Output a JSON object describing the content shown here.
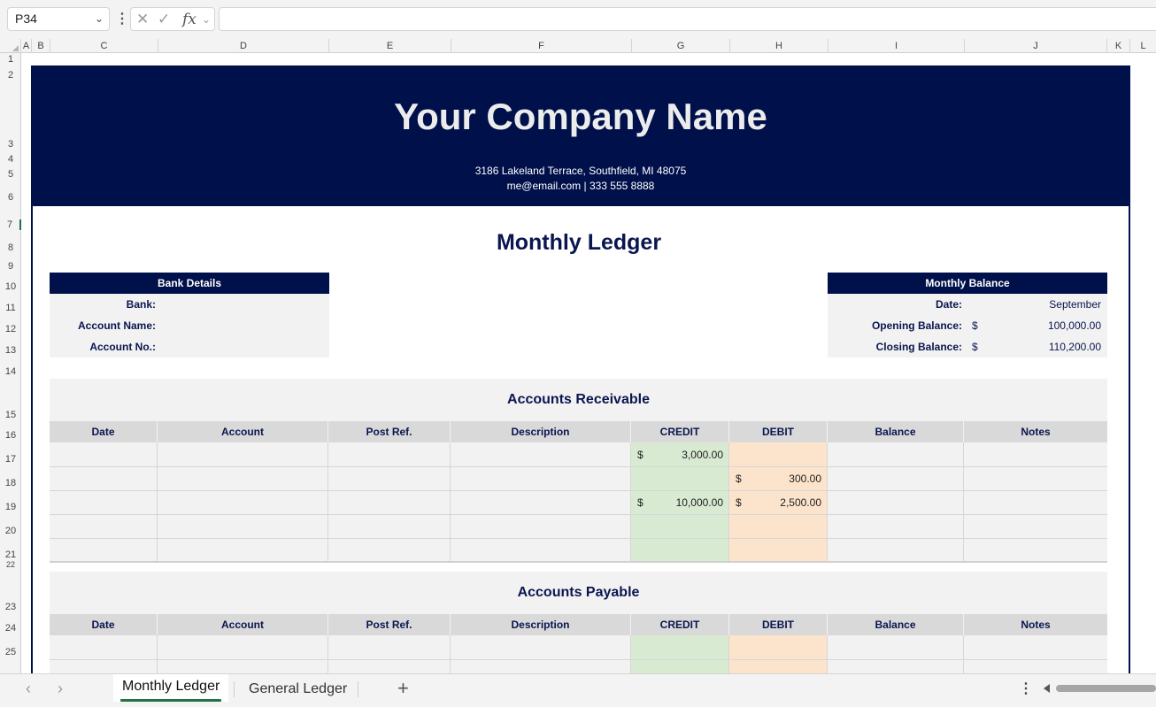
{
  "formula_bar": {
    "name_box": "P34",
    "formula": "",
    "icons": [
      "chevron-down-icon",
      "more-icon",
      "cancel-icon",
      "enter-icon",
      "function-icon"
    ]
  },
  "columns": [
    "A",
    "B",
    "C",
    "D",
    "E",
    "F",
    "G",
    "H",
    "I",
    "J",
    "K",
    "L"
  ],
  "rows": [
    "1",
    "2",
    "3",
    "4",
    "5",
    "6",
    "7",
    "8",
    "9",
    "10",
    "11",
    "12",
    "13",
    "14",
    "15",
    "16",
    "17",
    "18",
    "19",
    "20",
    "21",
    "22",
    "23",
    "24",
    "25"
  ],
  "header": {
    "company": "Your Company Name",
    "address": "3186 Lakeland Terrace, Southfield, MI 48075",
    "contact": "me@email.com | 333 555 8888"
  },
  "title": "Monthly Ledger",
  "bank_details": {
    "header": "Bank Details",
    "bank_label": "Bank:",
    "account_name_label": "Account Name:",
    "account_no_label": "Account No.:"
  },
  "monthly_balance": {
    "header": "Monthly Balance",
    "date_label": "Date:",
    "date_value": "September",
    "opening_label": "Opening Balance:",
    "opening_currency": "$",
    "opening_value": "100,000.00",
    "closing_label": "Closing Balance:",
    "closing_currency": "$",
    "closing_value": "110,200.00"
  },
  "table_headers": [
    "Date",
    "Account",
    "Post Ref.",
    "Description",
    "CREDIT",
    "DEBIT",
    "Balance",
    "Notes"
  ],
  "receivable": {
    "title": "Accounts Receivable",
    "rows": [
      {
        "credit_cur": "$",
        "credit": "3,000.00",
        "debit_cur": "",
        "debit": ""
      },
      {
        "credit_cur": "",
        "credit": "",
        "debit_cur": "$",
        "debit": "300.00"
      },
      {
        "credit_cur": "$",
        "credit": "10,000.00",
        "debit_cur": "$",
        "debit": "2,500.00"
      },
      {
        "credit_cur": "",
        "credit": "",
        "debit_cur": "",
        "debit": ""
      },
      {
        "credit_cur": "",
        "credit": "",
        "debit_cur": "",
        "debit": ""
      }
    ]
  },
  "payable": {
    "title": "Accounts Payable"
  },
  "tabs": {
    "active": "Monthly Ledger",
    "other": "General Ledger"
  },
  "colors": {
    "navy": "#00104a",
    "credit_fill": "#d9ead3",
    "debit_fill": "#fce4cc",
    "section_fill": "#f2f2f2",
    "header_fill": "#d9d9d9",
    "active_tab_accent": "#217346"
  }
}
